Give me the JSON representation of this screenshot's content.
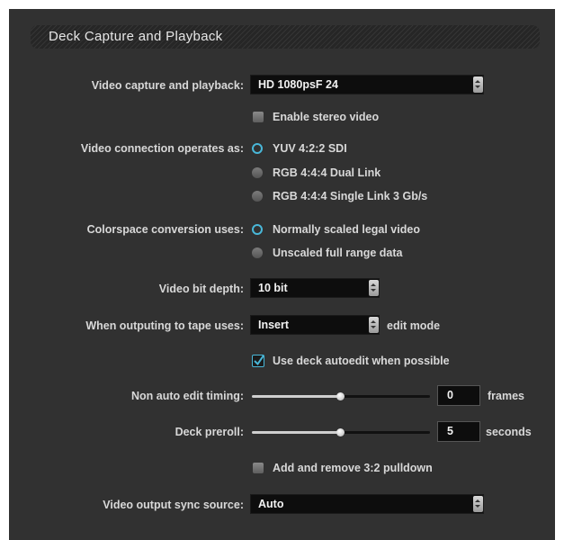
{
  "section_title": "Deck Capture and Playback",
  "video_capture": {
    "label": "Video capture and playback:",
    "value": "HD 1080psF 24"
  },
  "stereo": {
    "label": "Enable stereo video",
    "checked": false
  },
  "connection": {
    "label": "Video connection operates as:",
    "options": [
      "YUV 4:2:2 SDI",
      "RGB 4:4:4 Dual Link",
      "RGB 4:4:4 Single Link 3 Gb/s"
    ],
    "selected": "YUV 4:2:2 SDI"
  },
  "colorspace": {
    "label": "Colorspace conversion uses:",
    "options": [
      "Normally scaled legal video",
      "Unscaled full range data"
    ],
    "selected": "Normally scaled legal video"
  },
  "bit_depth": {
    "label": "Video bit depth:",
    "value": "10 bit"
  },
  "tape": {
    "label": "When outputing to tape uses:",
    "value": "Insert",
    "suffix": "edit mode"
  },
  "autoedit": {
    "label": "Use deck autoedit when possible",
    "checked": true
  },
  "non_auto_timing": {
    "label": "Non auto edit timing:",
    "value": "0",
    "unit": "frames",
    "slider_fraction": 0.5
  },
  "preroll": {
    "label": "Deck preroll:",
    "value": "5",
    "unit": "seconds",
    "slider_fraction": 0.5
  },
  "pulldown": {
    "label": "Add and remove 3:2 pulldown",
    "checked": false
  },
  "sync_source": {
    "label": "Video output sync source:",
    "value": "Auto"
  },
  "colors": {
    "panel": "#313131",
    "accent": "#49b7d8",
    "field_bg": "#0d0d0d",
    "text": "#d8d8d8"
  }
}
